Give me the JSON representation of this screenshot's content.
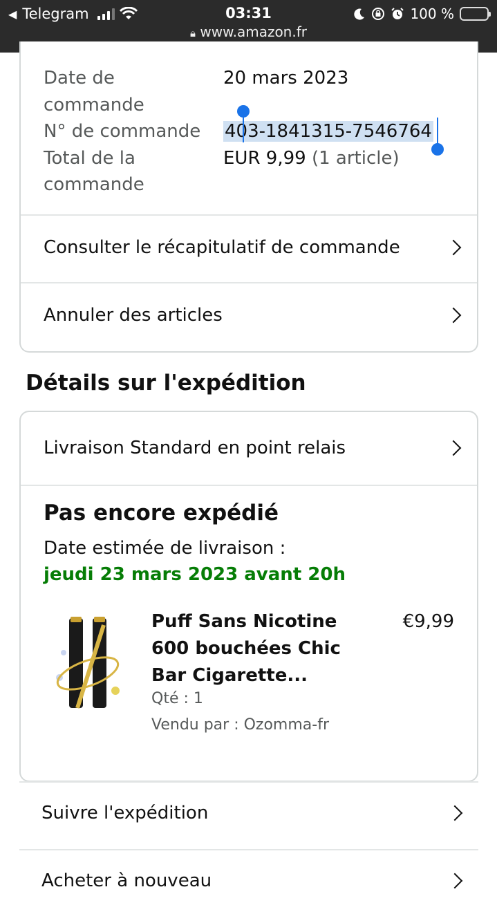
{
  "status_bar": {
    "back_app": "Telegram",
    "time": "03:31",
    "url": "www.amazon.fr",
    "battery": "100 %",
    "battery_color": "#f6c300",
    "icons": [
      "back-arrow-icon",
      "signal-icon",
      "wifi-icon",
      "lock-icon",
      "moon-icon",
      "rotation-lock-icon",
      "alarm-icon",
      "battery-icon"
    ]
  },
  "order_summary": {
    "date_label": "Date de commande",
    "date_value": "20 mars 2023",
    "number_label": "N° de commande",
    "number_value": "403-1841315-7546764",
    "total_label": "Total de la commande",
    "total_value": "EUR 9,99",
    "total_items": "(1 article)"
  },
  "links": {
    "recap": "Consulter le récapitulatif de commande",
    "cancel": "Annuler des articles"
  },
  "shipping": {
    "section_title": "Détails sur l'expédition",
    "method": "Livraison Standard en point relais",
    "status": "Pas encore expédié",
    "estimate_label": "Date estimée de livraison :",
    "estimate_date": "jeudi 23 mars 2023 avant 20h",
    "estimate_color": "#067d06"
  },
  "product": {
    "title": "Puff Sans Nicotine 600 bouchées Chic Bar Cigarette...",
    "price": "€9,99",
    "qty": "Qté : 1",
    "seller": "Vendu par : Ozomma-fr"
  },
  "actions": {
    "track": "Suivre l'expédition",
    "rebuy": "Acheter à nouveau"
  }
}
